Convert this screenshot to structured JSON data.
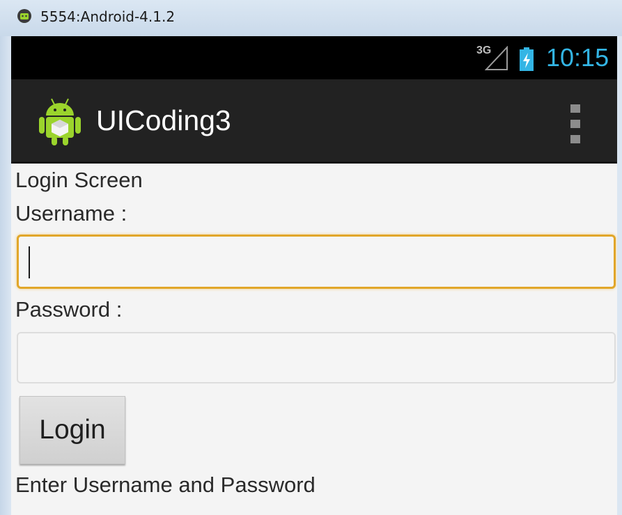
{
  "window": {
    "title": "5554:Android-4.1.2",
    "icon": "android-emulator-icon"
  },
  "status_bar": {
    "network_type": "3G",
    "clock": "10:15",
    "clock_color": "#33b5e5"
  },
  "action_bar": {
    "app_title": "UICoding3",
    "app_icon": "android-robot-icon",
    "overflow_icon": "overflow-menu-icon"
  },
  "form": {
    "heading": "Login Screen",
    "username_label": "Username :",
    "username_value": "",
    "password_label": "Password :",
    "password_value": "",
    "login_button": "Login",
    "status_message": "Enter Username and Password"
  },
  "colors": {
    "focus_border": "#e1a629",
    "action_bar": "#222222",
    "status_bar": "#000000"
  }
}
